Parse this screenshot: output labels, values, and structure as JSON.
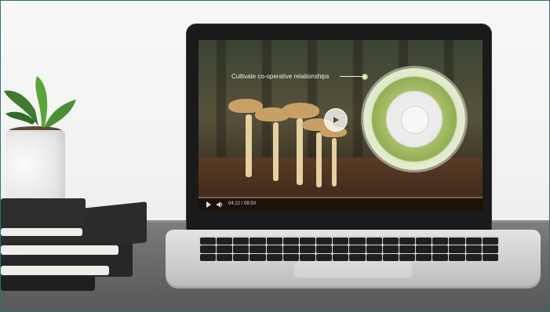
{
  "video": {
    "caption": "Cultivate co-operative relationships",
    "time_display": "04:22 / 08:50"
  },
  "icons": {
    "play": "play-icon",
    "volume": "volume-icon"
  },
  "colors": {
    "frame_border": "#2e6e79",
    "wheel_green": "#93ad53"
  }
}
